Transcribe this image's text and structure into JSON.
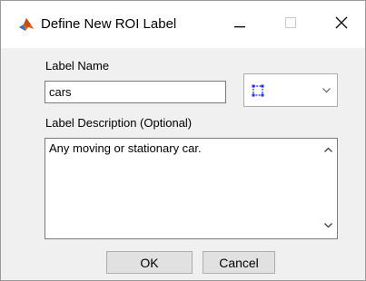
{
  "window": {
    "title": "Define New ROI Label",
    "icon": "matlab-icon",
    "controls": {
      "minimize": "minimize-icon",
      "maximize": "maximize-icon",
      "close": "close-icon"
    }
  },
  "form": {
    "label_name_caption": "Label Name",
    "label_name_value": "cars",
    "shape_selector_icon": "rectangle-roi-icon",
    "shape_selector_color": "#1f2bd6",
    "description_caption": "Label Description (Optional)",
    "description_value": "Any moving or stationary car."
  },
  "buttons": {
    "ok": "OK",
    "cancel": "Cancel"
  }
}
